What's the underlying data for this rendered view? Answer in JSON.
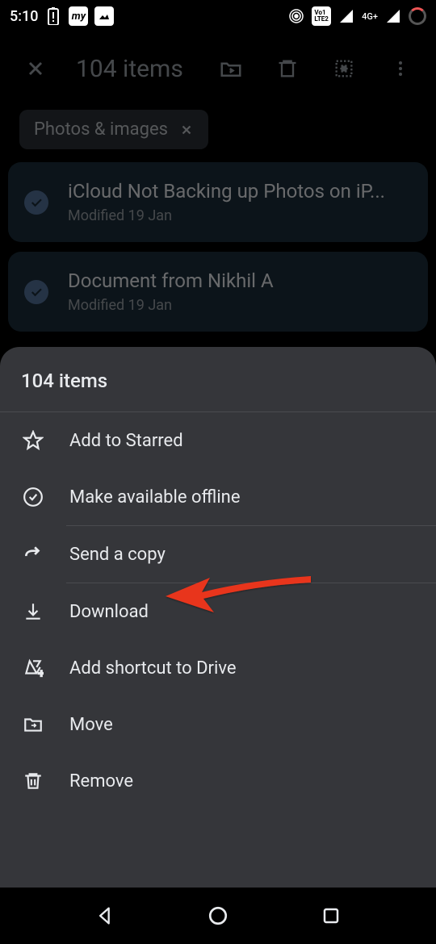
{
  "status": {
    "time": "5:10"
  },
  "topbar": {
    "title": "104 items"
  },
  "chip": {
    "label": "Photos & images"
  },
  "files": [
    {
      "title": "iCloud Not Backing up Photos on iP...",
      "subtitle": "Modified 19 Jan"
    },
    {
      "title": "Document from Nikhil A",
      "subtitle": "Modified 19 Jan"
    }
  ],
  "sheet": {
    "header": "104 items",
    "items": {
      "starred": "Add to Starred",
      "offline": "Make available offline",
      "send_copy": "Send a copy",
      "download": "Download",
      "shortcut": "Add shortcut to Drive",
      "move": "Move",
      "remove": "Remove"
    }
  }
}
